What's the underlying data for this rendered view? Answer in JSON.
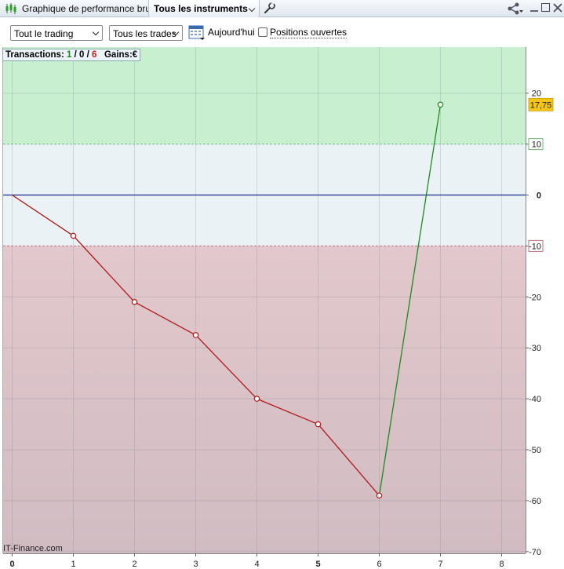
{
  "window": {
    "title": "Graphique de performance brute",
    "instrument_selector": "Tous les instruments",
    "icons": [
      "candlestick-icon",
      "wrench-icon",
      "share-icon",
      "minimize-icon",
      "maximize-icon",
      "close-icon"
    ]
  },
  "toolbar": {
    "trading_filter": "Tout le trading",
    "trades_filter": "Tous les trades",
    "date_label": "Aujourd'hui",
    "open_positions_label": "Positions ouvertes",
    "open_positions_checked": false
  },
  "summary": {
    "label": "Transactions:",
    "winning": "1",
    "neutral": "0",
    "losing": "6",
    "separator": " / ",
    "gains_label": "Gains:",
    "currency": "€"
  },
  "watermark": "IT-Finance.com",
  "chart_data": {
    "type": "line",
    "x": [
      0,
      1,
      2,
      3,
      4,
      5,
      6,
      7
    ],
    "y": [
      0,
      -8,
      -21,
      -27.5,
      -40,
      -45,
      -59,
      17.75
    ],
    "xlim": [
      0,
      8.3
    ],
    "ylim": [
      -70,
      30
    ],
    "x_ticks": [
      "0",
      "1",
      "2",
      "3",
      "4",
      "5",
      "6",
      "7",
      "8"
    ],
    "y_ticks": [
      "20",
      "10",
      "0",
      "-10",
      "-20",
      "-30",
      "-40",
      "-50",
      "-60",
      "-70"
    ],
    "last_value_label": "17,75",
    "bands": {
      "upper_threshold": 10,
      "lower_threshold": -10,
      "upper_color": "#c8efd0",
      "middle_color": "#eaf2f6",
      "lower_color": "#dcc2c6"
    },
    "colors": {
      "loss_segment": "#b01818",
      "gain_segment": "#1c8a1c",
      "zero_line": "#1a2f8a",
      "label_highlight": "#f5c518"
    },
    "grid": true
  }
}
